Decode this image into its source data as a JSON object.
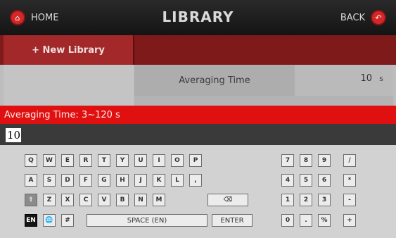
{
  "header": {
    "home_label": "HOME",
    "title": "LIBRARY",
    "back_label": "BACK"
  },
  "library": {
    "new_button_label": "+ New Library"
  },
  "parameter": {
    "label": "Averaging Time",
    "value": "10",
    "unit": "s"
  },
  "hint": "Averaging Time: 3~120 s",
  "input": {
    "value": "10"
  },
  "keyboard": {
    "row1": [
      "Q",
      "W",
      "E",
      "R",
      "T",
      "Y",
      "U",
      "I",
      "O",
      "P"
    ],
    "row2": [
      "A",
      "S",
      "D",
      "F",
      "G",
      "H",
      "J",
      "K",
      "L",
      ","
    ],
    "row3": [
      "Z",
      "X",
      "C",
      "V",
      "B",
      "N",
      "M"
    ],
    "shift_icon": "⇧",
    "backspace_icon": "⌫",
    "lang_label": "EN",
    "globe_icon": "🌐",
    "hash_label": "#",
    "space_label": "SPACE (EN)",
    "enter_label": "ENTER",
    "numpad": [
      [
        "7",
        "8",
        "9",
        "/"
      ],
      [
        "4",
        "5",
        "6",
        "*"
      ],
      [
        "1",
        "2",
        "3",
        "-"
      ],
      [
        "0",
        ".",
        "%",
        "+"
      ]
    ]
  },
  "colors": {
    "accent_red": "#e01010",
    "dark_red": "#7f1a1b",
    "button_red": "#a3282a"
  }
}
